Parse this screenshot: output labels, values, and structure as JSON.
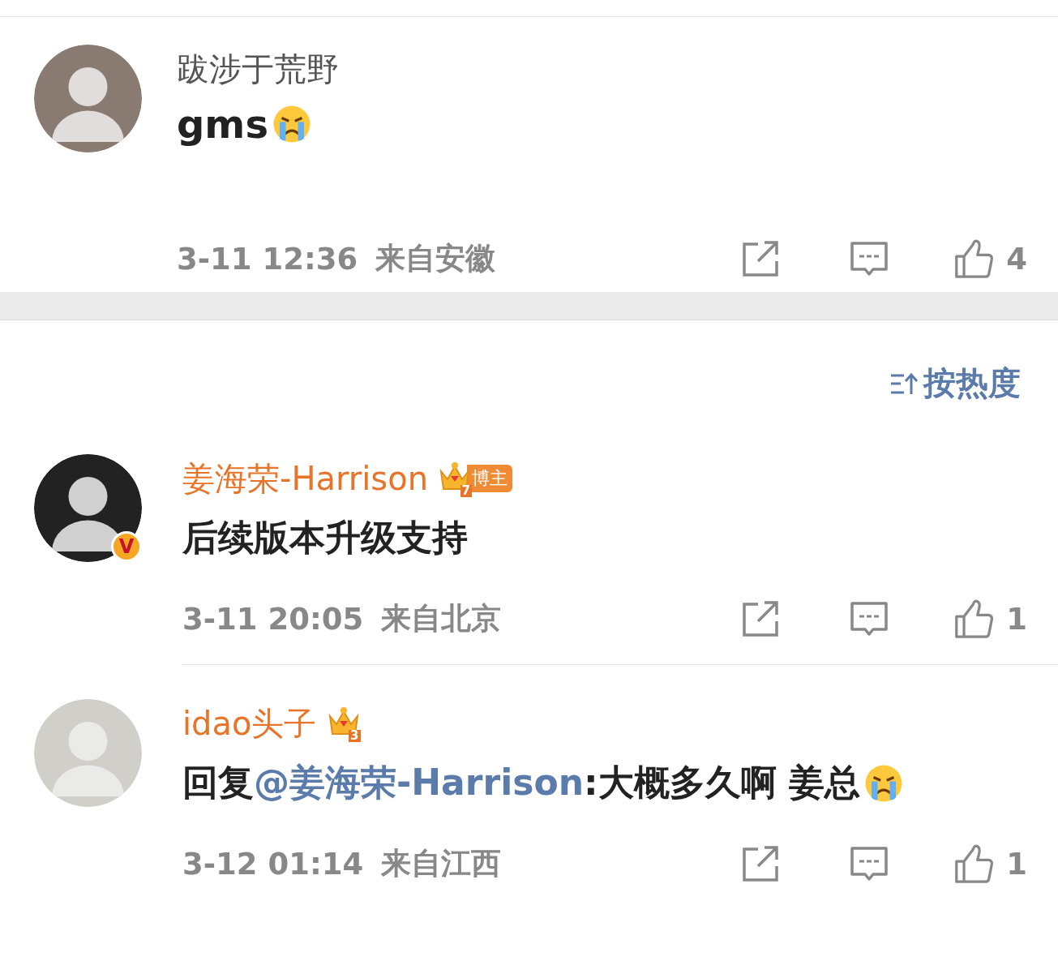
{
  "top_comment": {
    "name": "跋涉于荒野",
    "highlighted": false,
    "body": [
      {
        "kind": "text",
        "text": "gms"
      },
      {
        "kind": "emoji"
      }
    ],
    "time": "3-11 12:36",
    "location": "来自安徽",
    "likes": "4"
  },
  "sort": {
    "label": "按热度"
  },
  "comments": [
    {
      "name": "姜海荣-Harrison",
      "highlighted": true,
      "verified": "V",
      "badges": [
        {
          "kind": "crown",
          "level": "7",
          "label": "博主"
        }
      ],
      "body": [
        {
          "kind": "text",
          "text": "后续版本升级支持"
        }
      ],
      "time": "3-11 20:05",
      "location": "来自北京",
      "likes": "1"
    },
    {
      "name": "idao头子",
      "highlighted": true,
      "badges": [
        {
          "kind": "crown",
          "level": "3"
        }
      ],
      "body": [
        {
          "kind": "text",
          "text": "回复"
        },
        {
          "kind": "mention",
          "text": "@姜海荣-Harrison"
        },
        {
          "kind": "text",
          "text": ":大概多久啊 姜总 "
        },
        {
          "kind": "emoji"
        }
      ],
      "time": "3-12 01:14",
      "location": "来自江西",
      "likes": "1"
    }
  ]
}
